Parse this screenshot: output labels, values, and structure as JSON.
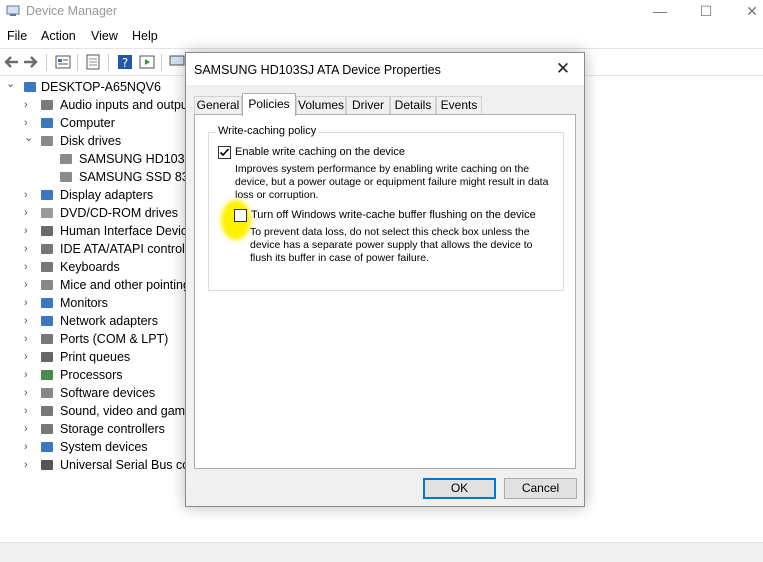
{
  "window": {
    "title": "Device Manager",
    "controls": {
      "minimize": "—",
      "maximize": "☐",
      "close": "✕"
    }
  },
  "menu": [
    "File",
    "Action",
    "View",
    "Help"
  ],
  "tree": {
    "root": "DESKTOP-A65NQV6",
    "items": [
      {
        "label": "Audio inputs and outputs",
        "expanded": false
      },
      {
        "label": "Computer",
        "expanded": false
      },
      {
        "label": "Disk drives",
        "expanded": true,
        "children": [
          "SAMSUNG HD103SJ ATA Device",
          "SAMSUNG SSD 830 Series"
        ]
      },
      {
        "label": "Display adapters",
        "expanded": false
      },
      {
        "label": "DVD/CD-ROM drives",
        "expanded": false
      },
      {
        "label": "Human Interface Devices",
        "expanded": false
      },
      {
        "label": "IDE ATA/ATAPI controllers",
        "expanded": false
      },
      {
        "label": "Keyboards",
        "expanded": false
      },
      {
        "label": "Mice and other pointing devices",
        "expanded": false
      },
      {
        "label": "Monitors",
        "expanded": false
      },
      {
        "label": "Network adapters",
        "expanded": false
      },
      {
        "label": "Ports (COM & LPT)",
        "expanded": false
      },
      {
        "label": "Print queues",
        "expanded": false
      },
      {
        "label": "Processors",
        "expanded": false
      },
      {
        "label": "Software devices",
        "expanded": false
      },
      {
        "label": "Sound, video and game controllers",
        "expanded": false
      },
      {
        "label": "Storage controllers",
        "expanded": false
      },
      {
        "label": "System devices",
        "expanded": false
      },
      {
        "label": "Universal Serial Bus controllers",
        "expanded": false
      }
    ]
  },
  "dialog": {
    "title": "SAMSUNG HD103SJ ATA Device Properties",
    "close": "✕",
    "tabs": [
      "General",
      "Policies",
      "Volumes",
      "Driver",
      "Details",
      "Events"
    ],
    "active_tab": "Policies",
    "group_label": "Write-caching policy",
    "option1": {
      "label": "Enable write caching on the device",
      "checked": true,
      "desc": [
        "Improves system performance by enabling write caching on the",
        "device, but a power outage or equipment failure might result in data",
        "loss or corruption."
      ]
    },
    "option2": {
      "label": "Turn off Windows write-cache buffer flushing on the device",
      "checked": false,
      "desc": [
        "To prevent data loss, do not select this check box unless the",
        "device has a separate power supply that allows the device to",
        "flush its buffer in case of power failure."
      ]
    },
    "ok": "OK",
    "cancel": "Cancel"
  },
  "colors": {
    "accent": "#0078d7",
    "highlight": "#fff200"
  }
}
